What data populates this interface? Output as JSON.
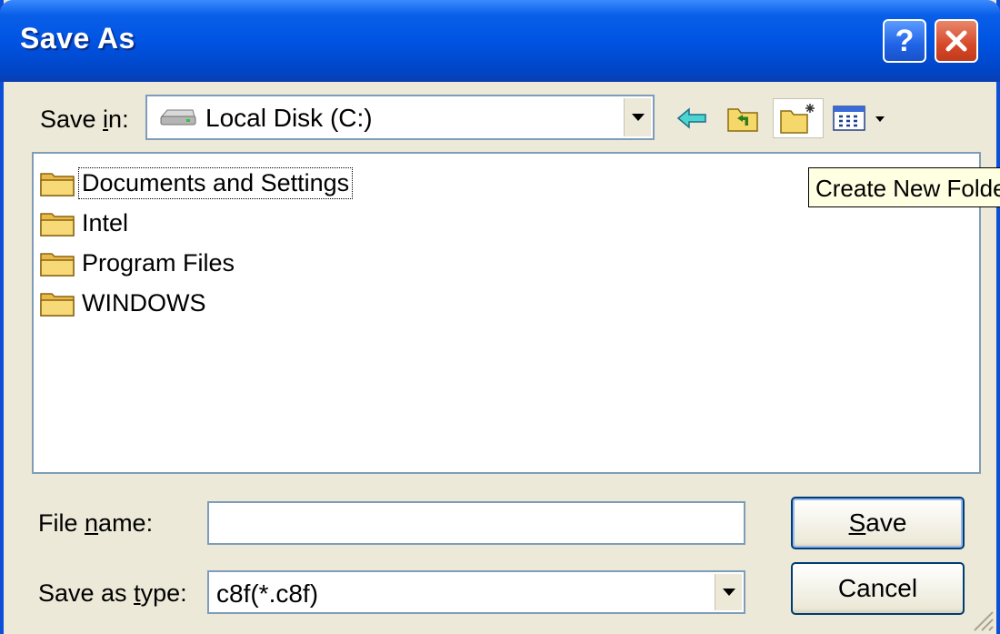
{
  "window": {
    "title": "Save As"
  },
  "titlebar": {
    "help_label": "?",
    "close_icon": "close-icon"
  },
  "save_in": {
    "label_prefix": "Save ",
    "label_accel": "i",
    "label_suffix": "n:",
    "value": "Local Disk (C:)",
    "icon": "hard-drive-icon"
  },
  "toolbar": {
    "icons": [
      "back-arrow-icon",
      "up-one-level-icon",
      "create-new-folder-icon",
      "view-menu-icon"
    ],
    "tooltip": "Create New Folder"
  },
  "files": [
    {
      "name": "Documents and Settings",
      "icon": "folder-icon",
      "focused": true
    },
    {
      "name": "Intel",
      "icon": "folder-icon"
    },
    {
      "name": "Program Files",
      "icon": "folder-icon"
    },
    {
      "name": "WINDOWS",
      "icon": "folder-icon"
    }
  ],
  "file_name": {
    "label_prefix": "File ",
    "label_accel": "n",
    "label_suffix": "ame:",
    "value": ""
  },
  "save_as_type": {
    "label_prefix": "Save as ",
    "label_accel": "t",
    "label_suffix": "ype:",
    "value": "c8f(*.c8f)"
  },
  "buttons": {
    "save_accel": "S",
    "save_rest": "ave",
    "cancel": "Cancel"
  },
  "colors": {
    "title_blue": "#0054e3",
    "close_red": "#d6482a",
    "dialog_bg": "#ece9d8",
    "tooltip_bg": "#ffffe1"
  }
}
